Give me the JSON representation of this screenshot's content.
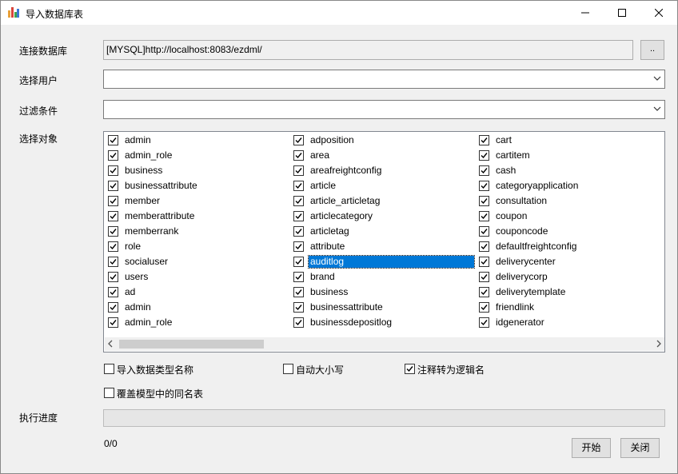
{
  "window": {
    "title": "导入数据库表"
  },
  "form": {
    "connection_label": "连接数据库",
    "connection_value": "[MYSQL]http://localhost:8083/ezdml/",
    "browse_label": "..",
    "user_label": "选择用户",
    "user_value": "",
    "filter_label": "过滤条件",
    "filter_value": "",
    "objects_label": "选择对象",
    "progress_label": "执行进度",
    "progress_value": 0,
    "count_text": "0/0"
  },
  "objects": {
    "columns": [
      [
        "admin",
        "admin_role",
        "business",
        "businessattribute",
        "member",
        "memberattribute",
        "memberrank",
        "role",
        "socialuser",
        "users",
        "ad",
        "admin",
        "admin_role"
      ],
      [
        "adposition",
        "area",
        "areafreightconfig",
        "article",
        "article_articletag",
        "articlecategory",
        "articletag",
        "attribute",
        "auditlog",
        "brand",
        "business",
        "businessattribute",
        "businessdepositlog"
      ],
      [
        "cart",
        "cartitem",
        "cash",
        "categoryapplication",
        "consultation",
        "coupon",
        "couponcode",
        "defaultfreightconfig",
        "deliverycenter",
        "deliverycorp",
        "deliverytemplate",
        "friendlink",
        "idgenerator"
      ]
    ],
    "selected": "auditlog",
    "all_checked": true
  },
  "options": {
    "import_type_names": {
      "label": "导入数据类型名称",
      "checked": false
    },
    "auto_case": {
      "label": "自动大小写",
      "checked": false
    },
    "comment_to_logical": {
      "label": "注释转为逻辑名",
      "checked": true
    },
    "overwrite_same_name": {
      "label": "覆盖模型中的同名表",
      "checked": false
    }
  },
  "buttons": {
    "start": "开始",
    "close": "关闭"
  },
  "colors": {
    "selection": "#0078d7",
    "background": "#f0f0f0"
  }
}
